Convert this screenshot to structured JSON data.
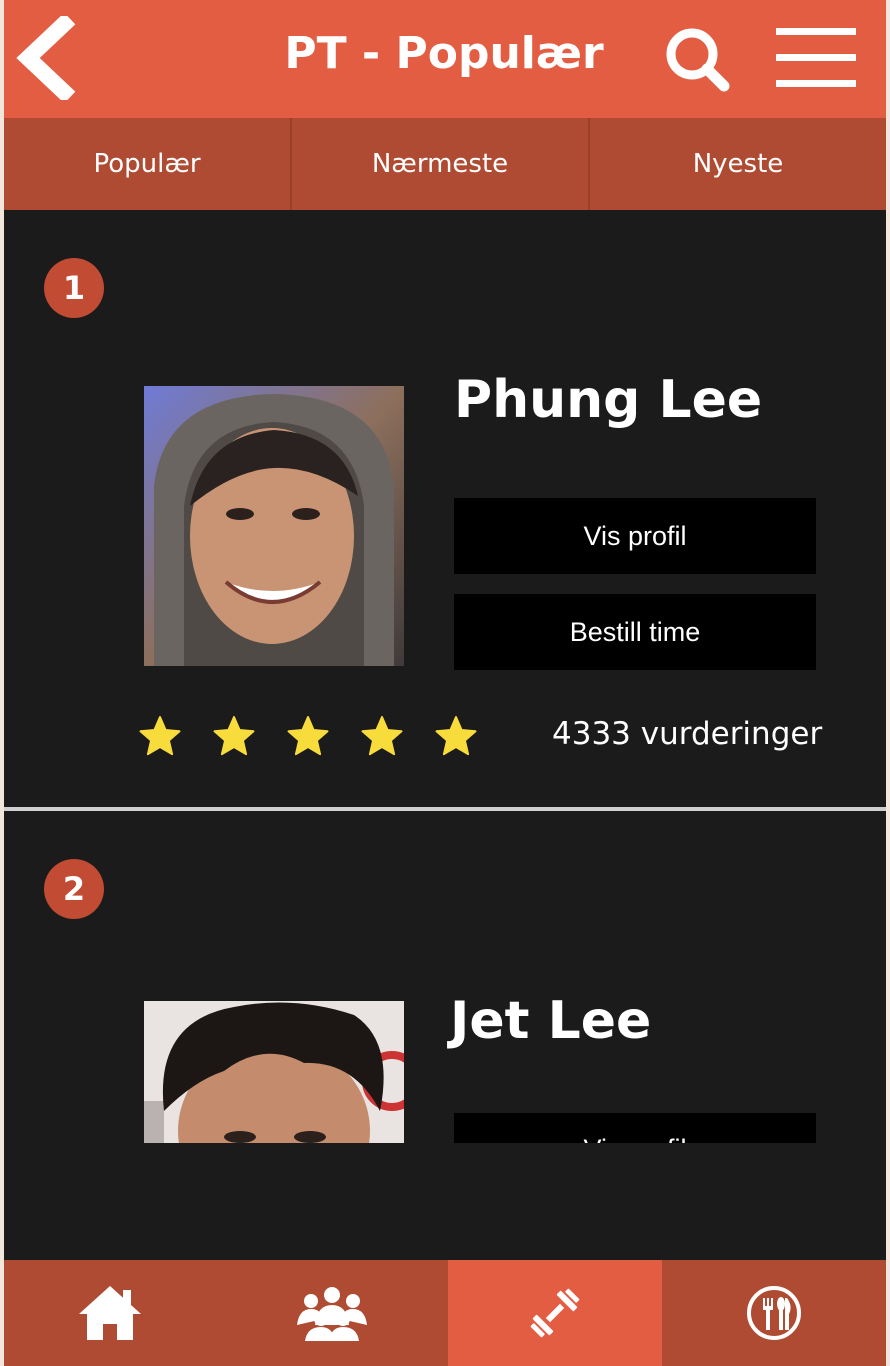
{
  "header": {
    "title": "PT - Populær",
    "back_icon": "chevron-left-icon",
    "search_icon": "search-icon",
    "menu_icon": "hamburger-menu-icon"
  },
  "tabs": [
    {
      "label": "Populær"
    },
    {
      "label": "Nærmeste"
    },
    {
      "label": "Nyeste"
    }
  ],
  "trainers": [
    {
      "rank": "1",
      "name": "Phung Lee",
      "view_profile_label": "Vis profil",
      "book_label": "Bestill time",
      "stars": 5,
      "ratings_text": "4333 vurderinger"
    },
    {
      "rank": "2",
      "name": "Jet Lee",
      "view_profile_label": "Vis profil"
    }
  ],
  "bottom_nav": [
    {
      "icon": "home-icon"
    },
    {
      "icon": "group-icon"
    },
    {
      "icon": "dumbbell-icon",
      "active": true
    },
    {
      "icon": "restaurant-icon"
    }
  ],
  "colors": {
    "header": "#e35d43",
    "tabs": "#b04b33",
    "background": "#1b1b1b",
    "rank_badge": "#c14b33",
    "star": "#f7dc3c"
  }
}
